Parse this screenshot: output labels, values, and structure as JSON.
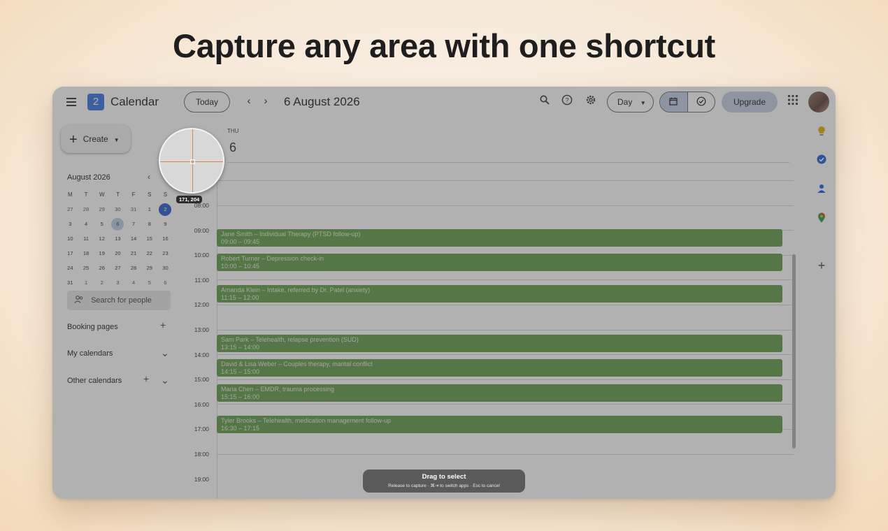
{
  "headline": "Capture any area with one shortcut",
  "calendar": {
    "logo_number": "2",
    "app_name": "Calendar",
    "today_label": "Today",
    "prev_icon": "chevron-left-icon",
    "next_icon": "chevron-right-icon",
    "date_title": "6 August 2026",
    "view_label": "Day",
    "upgrade_label": "Upgrade"
  },
  "sidebar": {
    "create_label": "Create",
    "mini_month": "August 2026",
    "weekday_headers": [
      "M",
      "T",
      "W",
      "T",
      "F",
      "S",
      "S"
    ],
    "weeks": [
      [
        "27",
        "28",
        "29",
        "30",
        "31",
        "1",
        "2"
      ],
      [
        "3",
        "4",
        "5",
        "6",
        "7",
        "8",
        "9"
      ],
      [
        "10",
        "11",
        "12",
        "13",
        "14",
        "15",
        "16"
      ],
      [
        "17",
        "18",
        "19",
        "20",
        "21",
        "22",
        "23"
      ],
      [
        "24",
        "25",
        "26",
        "27",
        "28",
        "29",
        "30"
      ],
      [
        "31",
        "1",
        "2",
        "3",
        "4",
        "5",
        "6"
      ]
    ],
    "today_day": "2",
    "selected_day": "6",
    "search_people_placeholder": "Search for people",
    "booking_pages_label": "Booking pages",
    "my_calendars_label": "My calendars",
    "other_calendars_label": "Other calendars"
  },
  "day_view": {
    "weekday": "THU",
    "day_number": "6",
    "hours": [
      "08:00",
      "09:00",
      "10:00",
      "11:00",
      "12:00",
      "13:00",
      "14:00",
      "15:00",
      "16:00",
      "17:00",
      "18:00",
      "19:00"
    ],
    "events": [
      {
        "title": "Jane Smith – Individual Therapy (PTSD follow-up)",
        "time": "09:00 – 09:45"
      },
      {
        "title": "Robert Turner – Depression check-in",
        "time": "10:00 – 10:45"
      },
      {
        "title": "Amanda Klein – Intake, referred by Dr. Patel (anxiety)",
        "time": "11:15 – 12:00"
      },
      {
        "title": "Sam Park – Telehealth, relapse prevention (SUD)",
        "time": "13:15 – 14:00"
      },
      {
        "title": "David & Lisa Weber – Couples therapy, marital conflict",
        "time": "14:15 – 15:00"
      },
      {
        "title": "Maria Chen – EMDR, trauma processing",
        "time": "15:15 – 16:00"
      },
      {
        "title": "Tyler Brooks – Telehealth, medication management follow-up",
        "time": "16:30 – 17:15"
      }
    ],
    "event_color": "#6fa35a"
  },
  "capture": {
    "coordinates": "171, 204",
    "toast_title": "Drag to select",
    "toast_hint": "Release to capture · ⌘⇥ to switch apps · Esc to cancel",
    "crosshair_color": "#e0824a"
  }
}
